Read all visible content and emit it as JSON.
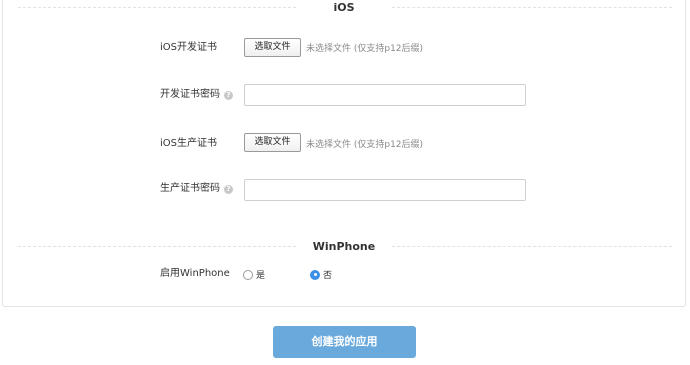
{
  "ios_section": {
    "title": "iOS",
    "dev_cert": {
      "label": "iOS开发证书",
      "button": "选取文件",
      "hint": "未选择文件 (仅支持p12后缀)"
    },
    "dev_password": {
      "label": "开发证书密码",
      "help": "?",
      "value": ""
    },
    "prod_cert": {
      "label": "iOS生产证书",
      "button": "选取文件",
      "hint": "未选择文件 (仅支持p12后缀)"
    },
    "prod_password": {
      "label": "生产证书密码",
      "help": "?",
      "value": ""
    }
  },
  "winphone_section": {
    "title": "WinPhone",
    "enable": {
      "label": "启用WinPhone",
      "options": [
        "是",
        "否"
      ],
      "selected": "否"
    }
  },
  "submit_label": "创建我的应用"
}
